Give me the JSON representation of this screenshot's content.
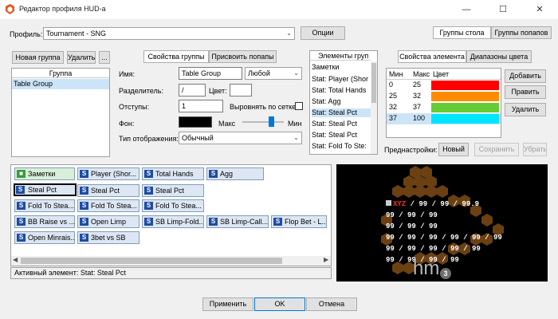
{
  "window": {
    "title": "Редактор профиля HUD-a",
    "minimize": "—",
    "maximize": "☐",
    "close": "✕"
  },
  "profile": {
    "label": "Профиль:",
    "value": "Tournament - SNG",
    "options_button": "Опции"
  },
  "top_tabs": [
    "Группы стола",
    "Группы попапов"
  ],
  "groups": {
    "new_button": "Новая группа",
    "delete_button": "Удалить",
    "more_button": "...",
    "header": "Группа",
    "items": [
      "Table Group"
    ]
  },
  "group_tabs": [
    "Свойства группы",
    "Присвоить попапы"
  ],
  "props": {
    "name_label": "Имя:",
    "name_value": "Table Group",
    "type_value": "Любой",
    "sep_label": "Разделитель:",
    "sep_value": "/",
    "color_label": "Цвет:",
    "indent_label": "Отступы:",
    "indent_value": "1",
    "grid_label": "Выровнять по сетке",
    "bg_label": "Фон:",
    "max_label": "Макс",
    "min_label": "Мин",
    "display_label": "Тип отображения:",
    "display_value": "Обычный"
  },
  "elements": {
    "header": "Элементы груп",
    "items": [
      "Заметки",
      "Stat: Player (Shor",
      "Stat: Total Hands",
      "Stat: Agg",
      "Stat: Steal Pct",
      "Stat: Steal Pct",
      "Stat: Steal Pct",
      "Stat: Fold To Ste:"
    ]
  },
  "element_tabs": [
    "Свойства элемента",
    "Диапазоны цвета"
  ],
  "ranges": {
    "headers": [
      "Мин",
      "Макс",
      "Цвет"
    ],
    "rows": [
      {
        "min": "0",
        "max": "25",
        "color": "#ff0000"
      },
      {
        "min": "25",
        "max": "32",
        "color": "#ff8c00"
      },
      {
        "min": "32",
        "max": "37",
        "color": "#66cc33"
      },
      {
        "min": "37",
        "max": "100",
        "color": "#00e5ff"
      }
    ]
  },
  "range_buttons": {
    "add": "Добавить",
    "edit": "Править",
    "delete": "Удалить"
  },
  "presets": {
    "label": "Преднастройки:",
    "new": "Новый",
    "save": "Сохранить",
    "remove": "Убрать"
  },
  "tiles": [
    [
      "Заметки",
      "Player (Shor...",
      "Total Hands",
      "Agg"
    ],
    [
      "Steal Pct",
      "Steal Pct",
      "Steal Pct"
    ],
    [
      "Fold To Stea...",
      "Fold To Stea...",
      "Fold To Stea..."
    ],
    [
      "BB Raise vs ...",
      "Open Limp",
      "SB Limp-Fold...",
      "SB Limp-Call...",
      "Flop Bet - L..."
    ],
    [
      "Open Minrais...",
      "3bet vs SB"
    ]
  ],
  "tile_icons": {
    "note": "■",
    "stat": "S"
  },
  "status": "Активный элемент: Stat: Steal Pct",
  "preview": {
    "line1_name": "XYZ",
    "line1_rest": "/ 99 / 99 / 99.9",
    "line2": "99 / 99 / 99",
    "line3": "99 / 99 / 99",
    "line4": "99 / 99 / 99 / 99 / 99 / 99",
    "line5": "99 / 99 / 99 / 99 / 99",
    "line6": "99 / 99 / 99 / 99",
    "logo": "hm",
    "logo_num": "3"
  },
  "footer": {
    "apply": "Применить",
    "ok": "OK",
    "cancel": "Отмена"
  }
}
